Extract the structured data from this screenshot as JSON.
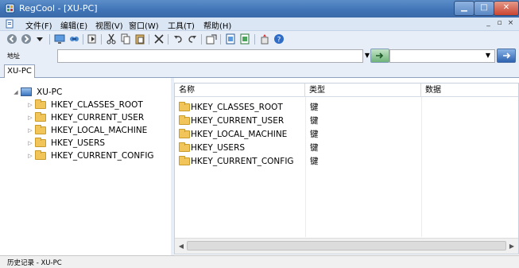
{
  "window": {
    "title": "RegCool - [XU-PC]"
  },
  "menu": {
    "items": [
      "文件(F)",
      "编辑(E)",
      "视图(V)",
      "窗口(W)",
      "工具(T)",
      "帮助(H)"
    ],
    "mdi_min": "_",
    "mdi_restore": "▫",
    "mdi_close": "×"
  },
  "toolbar": {
    "icons": [
      "back-icon",
      "forward-icon",
      "dropdown-icon",
      "computer-icon",
      "connect-icon",
      "import-icon",
      "cut-icon",
      "copy-icon",
      "paste-icon",
      "delete-icon",
      "undo-icon",
      "redo-icon",
      "export-icon",
      "compare-icon",
      "refresh-icon",
      "favorites-icon",
      "help-icon"
    ]
  },
  "address": {
    "label": "地址",
    "value": "",
    "search_value": ""
  },
  "tabs": [
    {
      "label": "XU-PC",
      "active": true
    }
  ],
  "tree": {
    "root": "XU-PC",
    "children": [
      "HKEY_CLASSES_ROOT",
      "HKEY_CURRENT_USER",
      "HKEY_LOCAL_MACHINE",
      "HKEY_USERS",
      "HKEY_CURRENT_CONFIG"
    ]
  },
  "list": {
    "columns": [
      "名称",
      "类型",
      "数据"
    ],
    "rows": [
      {
        "name": "HKEY_CLASSES_ROOT",
        "type": "键",
        "data": ""
      },
      {
        "name": "HKEY_CURRENT_USER",
        "type": "键",
        "data": ""
      },
      {
        "name": "HKEY_LOCAL_MACHINE",
        "type": "键",
        "data": ""
      },
      {
        "name": "HKEY_USERS",
        "type": "键",
        "data": ""
      },
      {
        "name": "HKEY_CURRENT_CONFIG",
        "type": "键",
        "data": ""
      }
    ]
  },
  "status": {
    "text": "历史记录 - XU-PC"
  },
  "colors": {
    "titlebar": "#3f73b5",
    "menubar": "#dbe6f4",
    "toolbar": "#e8eef7",
    "folder": "#f2c55b"
  }
}
